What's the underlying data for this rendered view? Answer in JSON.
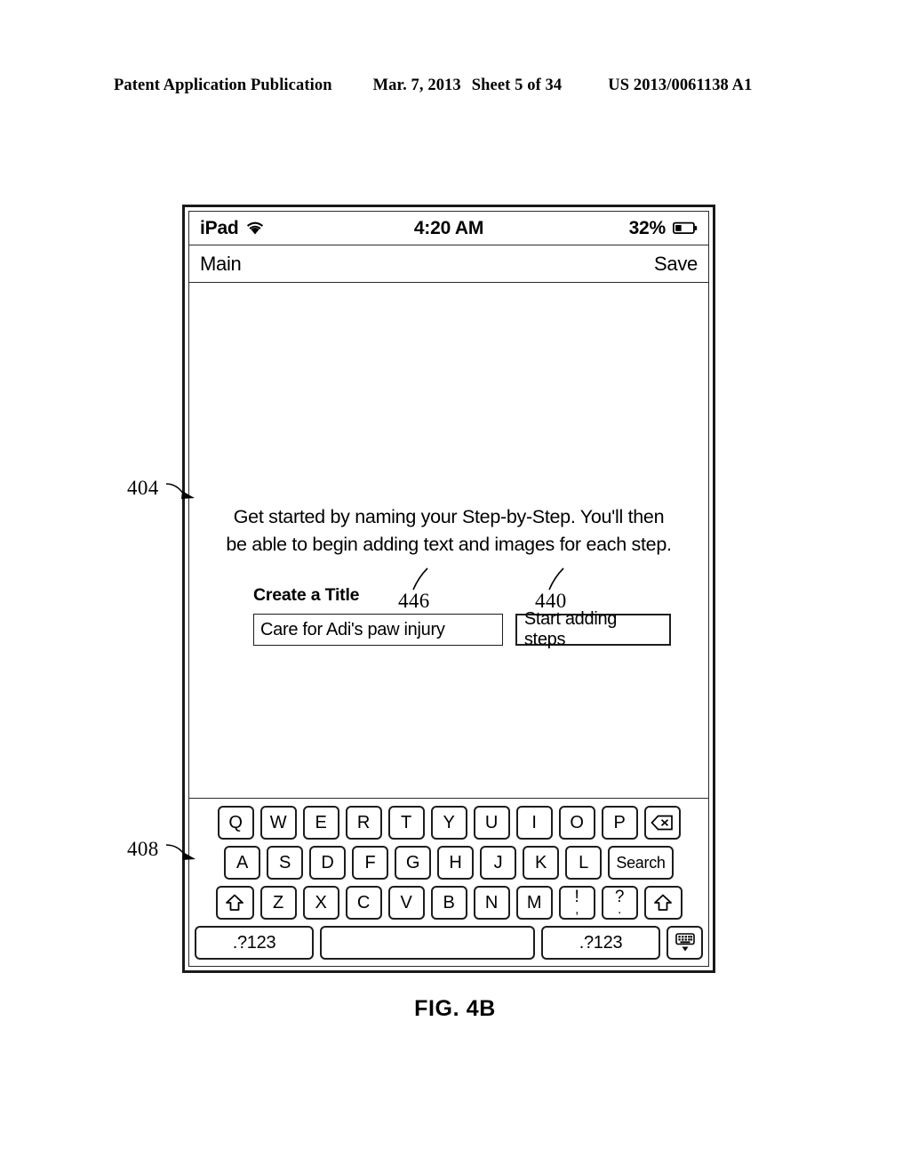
{
  "patent_header": {
    "publication": "Patent Application Publication",
    "date": "Mar. 7, 2013",
    "sheet": "Sheet 5 of 34",
    "number": "US 2013/0061138 A1"
  },
  "figure": {
    "caption": "FIG. 4B"
  },
  "callouts": {
    "device": "404",
    "keyboard": "408",
    "title_field": "446",
    "start_button": "440"
  },
  "device": {
    "status_bar": {
      "carrier": "iPad",
      "wifi_icon": "wifi-icon",
      "time": "4:20 AM",
      "battery_percent": "32%",
      "battery_icon": "battery-icon"
    },
    "nav_bar": {
      "back_label": "Main",
      "save_label": "Save"
    },
    "content": {
      "intro_line1": "Get started by naming your Step-by-Step. You'll then",
      "intro_line2": "be able to begin adding text and images for each step.",
      "field_label": "Create a Title",
      "title_value": "Care for Adi's paw injury",
      "title_placeholder": "Create a Title",
      "start_button_label": "Start adding steps"
    },
    "keyboard": {
      "row1": [
        {
          "label": "Q",
          "name": "key-q",
          "type": "letter"
        },
        {
          "label": "W",
          "name": "key-w",
          "type": "letter"
        },
        {
          "label": "E",
          "name": "key-e",
          "type": "letter"
        },
        {
          "label": "R",
          "name": "key-r",
          "type": "letter"
        },
        {
          "label": "T",
          "name": "key-t",
          "type": "letter"
        },
        {
          "label": "Y",
          "name": "key-y",
          "type": "letter"
        },
        {
          "label": "U",
          "name": "key-u",
          "type": "letter"
        },
        {
          "label": "I",
          "name": "key-i",
          "type": "letter"
        },
        {
          "label": "O",
          "name": "key-o",
          "type": "letter"
        },
        {
          "label": "P",
          "name": "key-p",
          "type": "letter"
        },
        {
          "label": "",
          "name": "backspace-icon",
          "type": "backspace"
        }
      ],
      "row2": [
        {
          "label": "A",
          "name": "key-a",
          "type": "letter"
        },
        {
          "label": "S",
          "name": "key-s",
          "type": "letter"
        },
        {
          "label": "D",
          "name": "key-d",
          "type": "letter"
        },
        {
          "label": "F",
          "name": "key-f",
          "type": "letter"
        },
        {
          "label": "G",
          "name": "key-g",
          "type": "letter"
        },
        {
          "label": "H",
          "name": "key-h",
          "type": "letter"
        },
        {
          "label": "J",
          "name": "key-j",
          "type": "letter"
        },
        {
          "label": "K",
          "name": "key-k",
          "type": "letter"
        },
        {
          "label": "L",
          "name": "key-l",
          "type": "letter"
        },
        {
          "label": "Search",
          "name": "key-search",
          "type": "wide-search"
        }
      ],
      "row3": [
        {
          "label": "",
          "name": "shift-icon-left",
          "type": "shift"
        },
        {
          "label": "Z",
          "name": "key-z",
          "type": "letter"
        },
        {
          "label": "X",
          "name": "key-x",
          "type": "letter"
        },
        {
          "label": "C",
          "name": "key-c",
          "type": "letter"
        },
        {
          "label": "V",
          "name": "key-v",
          "type": "letter"
        },
        {
          "label": "B",
          "name": "key-b",
          "type": "letter"
        },
        {
          "label": "N",
          "name": "key-n",
          "type": "letter"
        },
        {
          "label": "M",
          "name": "key-m",
          "type": "letter"
        },
        {
          "label": "!",
          "sub": ",",
          "name": "key-exclamation-comma",
          "type": "dual"
        },
        {
          "label": "?",
          "sub": ".",
          "name": "key-question-period",
          "type": "dual"
        },
        {
          "label": "",
          "name": "shift-icon-right",
          "type": "shift"
        }
      ],
      "row4": [
        {
          "label": ".?123",
          "name": "key-numeric-left",
          "type": "wide-num"
        },
        {
          "label": "",
          "name": "key-space",
          "type": "space"
        },
        {
          "label": ".?123",
          "name": "key-numeric-right",
          "type": "wide-num"
        },
        {
          "label": "",
          "name": "hide-keyboard-icon",
          "type": "hide"
        }
      ]
    }
  }
}
